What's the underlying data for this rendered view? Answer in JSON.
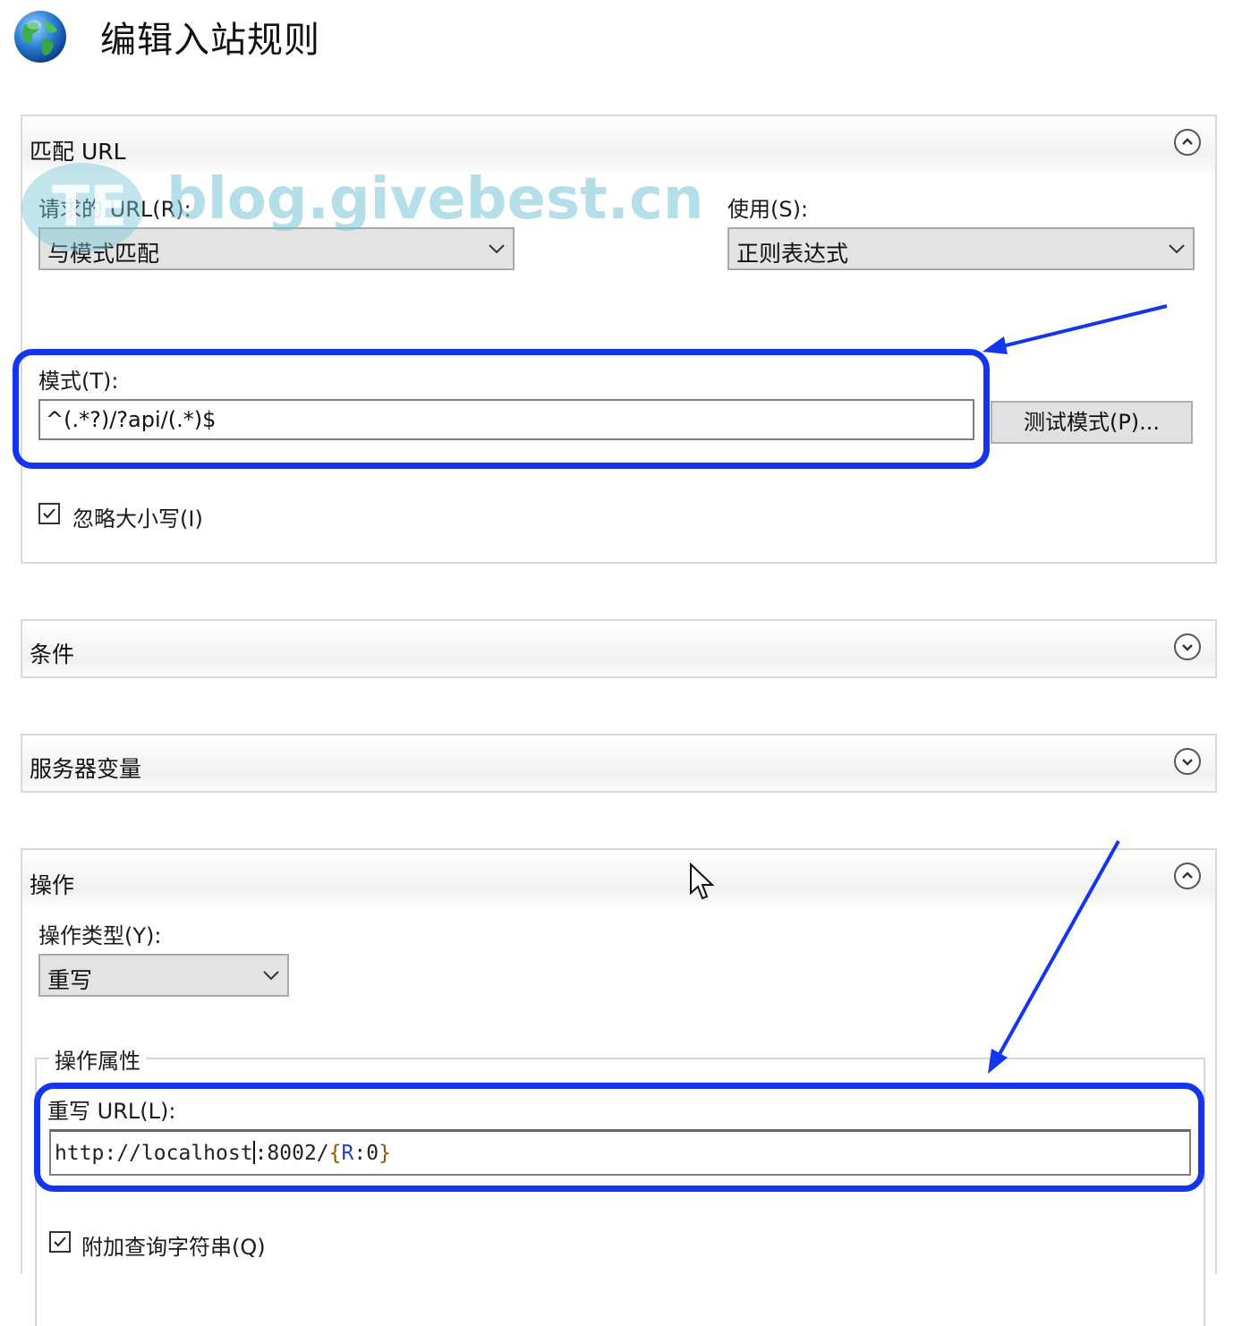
{
  "header": {
    "icon": "globe-icon",
    "title": "编辑入站规则"
  },
  "watermark": {
    "text": "blog.givebest.cn",
    "logo_text": "TE"
  },
  "match_url": {
    "title": "匹配 URL",
    "state": "expanded",
    "requested_url_label": "请求的 URL(R):",
    "requested_url_value": "与模式匹配",
    "using_label": "使用(S):",
    "using_value": "正则表达式",
    "pattern_label": "模式(T):",
    "pattern_value": "^(.*?)/?api/(.*)$",
    "test_pattern_button": "测试模式(P)...",
    "ignore_case_label": "忽略大小写(I)",
    "ignore_case_checked": true
  },
  "conditions": {
    "title": "条件",
    "state": "collapsed"
  },
  "server_variables": {
    "title": "服务器变量",
    "state": "collapsed"
  },
  "action": {
    "title": "操作",
    "state": "expanded",
    "action_type_label": "操作类型(Y):",
    "action_type_value": "重写",
    "properties_legend": "操作属性",
    "rewrite_url_label": "重写 URL(L):",
    "rewrite_url_value": "http://localhost:8002/{R:0}",
    "rewrite_url_parts": {
      "before_caret": "http://localhost",
      "after_caret": ":8002/",
      "brace_open": "{",
      "variable": "R",
      "var_rest": ":0",
      "brace_close": "}"
    },
    "append_query_label": "附加查询字符串(Q)",
    "append_query_checked": true
  },
  "annotations": {
    "highlight_color": "#1435ee"
  }
}
